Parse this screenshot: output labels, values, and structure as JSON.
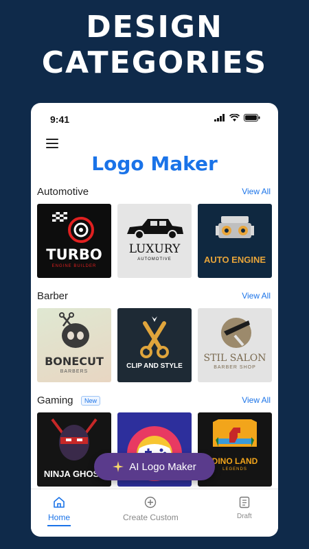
{
  "promo": {
    "line1": "DESIGN",
    "line2": "CATEGORIES"
  },
  "status": {
    "time": "9:41"
  },
  "app": {
    "title": "Logo Maker"
  },
  "sections": [
    {
      "label": "Automotive",
      "view_all": "View All",
      "badge": "",
      "tiles": [
        {
          "main": "TURBO",
          "sub": "ENGINE BUILDER",
          "bg": "#0d0d0d"
        },
        {
          "main": "LUXURY",
          "sub": "AUTOMOTIVE",
          "bg": "#e5e5e5"
        },
        {
          "main": "AUTO ENGINE",
          "sub": "",
          "bg": "#0f2840"
        }
      ]
    },
    {
      "label": "Barber",
      "view_all": "View All",
      "badge": "",
      "tiles": [
        {
          "main": "BONECUT",
          "sub": "BARBERS",
          "bg": "#e9dcc8"
        },
        {
          "main": "CLIP AND STYLE",
          "sub": "",
          "bg": "#1e2a35"
        },
        {
          "main": "STIL SALON",
          "sub": "BARBER SHOP",
          "bg": "#e3e3e3"
        }
      ]
    },
    {
      "label": "Gaming",
      "view_all": "View All",
      "badge": "New",
      "tiles": [
        {
          "main": "NINJA GHOST",
          "sub": "",
          "bg": "#141414"
        },
        {
          "main": "",
          "sub": "",
          "bg": "#2d2f9c"
        },
        {
          "main": "DINO LAND",
          "sub": "LEGENDS",
          "bg": "#141414"
        }
      ]
    }
  ],
  "ai_button": {
    "label": "AI Logo Maker"
  },
  "tabs": {
    "home": "Home",
    "create": "Create Custom",
    "draft": "Draft"
  }
}
